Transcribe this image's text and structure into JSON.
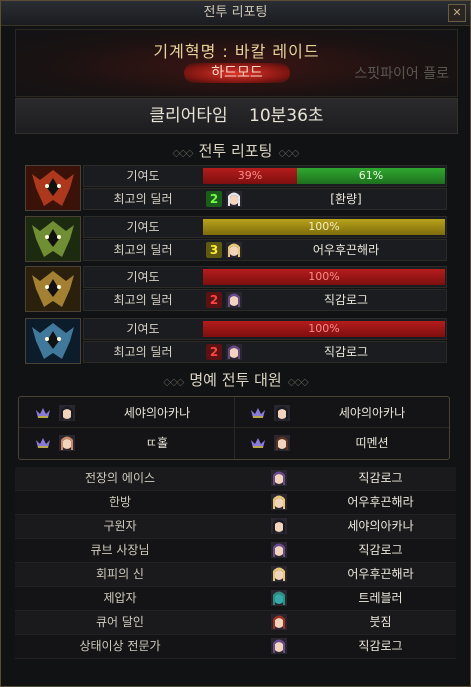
{
  "window": {
    "title": "전투 리포팅",
    "close": "✕"
  },
  "header": {
    "raid_name": "기계혁명 : 바칼 레이드",
    "mode": "하드모드",
    "watermark": "스핏파이어 플로"
  },
  "clear": {
    "label": "클리어타임",
    "time": "10분36초"
  },
  "report": {
    "section_title": "전투 리포팅",
    "contribution_label": "기여도",
    "top_dealer_label": "최고의 딜러",
    "bosses": [
      {
        "icon": "red-dragon-boss-icon",
        "bars": [
          {
            "text": "39%",
            "value": 39,
            "color": "red"
          },
          {
            "text": "61%",
            "value": 61,
            "color": "green"
          }
        ],
        "rank": "2",
        "rank_color": "green",
        "dealer": "[환량]",
        "avatar": "white-hair-avatar"
      },
      {
        "icon": "green-dragon-boss-icon",
        "bars": [
          {
            "text": "100%",
            "value": 100,
            "color": "gold"
          }
        ],
        "rank": "3",
        "rank_color": "yellow",
        "dealer": "어우후끈해라",
        "avatar": "blonde-avatar"
      },
      {
        "icon": "gold-dragon-boss-icon",
        "bars": [
          {
            "text": "100%",
            "value": 100,
            "color": "red"
          }
        ],
        "rank": "2",
        "rank_color": "red",
        "dealer": "직감로그",
        "avatar": "purple-hair-avatar"
      },
      {
        "icon": "blue-dragon-boss-icon",
        "bars": [
          {
            "text": "100%",
            "value": 100,
            "color": "red"
          }
        ],
        "rank": "2",
        "rank_color": "red",
        "dealer": "직감로그",
        "avatar": "purple-hair-avatar"
      }
    ]
  },
  "honor": {
    "section_title": "명예 전투 대원",
    "members": [
      {
        "name": "세야의아카나",
        "avatar": "dark-hair-avatar"
      },
      {
        "name": "세야의아카나",
        "avatar": "dark-hair-avatar"
      },
      {
        "name": "ㄸ홀",
        "avatar": "bald-avatar"
      },
      {
        "name": "띠멘션",
        "avatar": "brown-hair-avatar"
      }
    ]
  },
  "awards": [
    {
      "title": "전장의 에이스",
      "name": "직감로그",
      "avatar": "purple-hair-avatar"
    },
    {
      "title": "한방",
      "name": "어우후끈해라",
      "avatar": "blonde-avatar"
    },
    {
      "title": "구원자",
      "name": "세야의아카나",
      "avatar": "dark-hair-avatar"
    },
    {
      "title": "큐브 사장님",
      "name": "직감로그",
      "avatar": "purple-hair-avatar"
    },
    {
      "title": "회피의 신",
      "name": "어우후끈해라",
      "avatar": "blonde-avatar"
    },
    {
      "title": "제압자",
      "name": "트레블러",
      "avatar": "teal-avatar"
    },
    {
      "title": "큐어 달인",
      "name": "붓짐",
      "avatar": "red-hair-avatar"
    },
    {
      "title": "상태이상 전문가",
      "name": "직감로그",
      "avatar": "purple-hair-avatar"
    }
  ],
  "colors": {
    "accent_gold": "#e8d19a",
    "hard_mode_red": "#e0332a",
    "bar_red": "#b51c1c",
    "bar_green": "#2fa82f",
    "bar_gold": "#b9a21a"
  }
}
